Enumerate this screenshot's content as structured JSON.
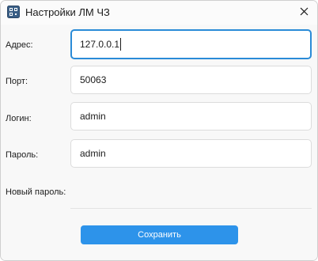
{
  "window": {
    "title": "Настройки ЛМ ЧЗ"
  },
  "form": {
    "address": {
      "label": "Адрес:",
      "value": "127.0.0.1"
    },
    "port": {
      "label": "Порт:",
      "value": "50063"
    },
    "login": {
      "label": "Логин:",
      "value": "admin"
    },
    "password": {
      "label": "Пароль:",
      "value": "admin"
    },
    "new_password": {
      "label": "Новый пароль:",
      "value": ""
    }
  },
  "actions": {
    "save_label": "Сохранить"
  },
  "colors": {
    "accent": "#2d93ea",
    "focus_border": "#2a8bd7"
  },
  "icons": {
    "app": "app-logo-icon",
    "close": "close-icon"
  }
}
